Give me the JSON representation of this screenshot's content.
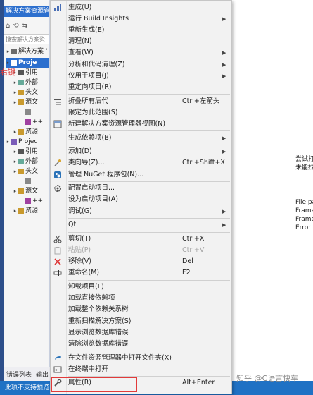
{
  "explorer": {
    "title": "解决方案资源管",
    "search_placeholder": "搜索解决方案资",
    "toolbar": [
      "⌂",
      "⟲",
      "⇆"
    ],
    "right_click_note": "右键",
    "rows": [
      {
        "label": "解决方案 '",
        "depth": 0
      },
      {
        "label": "Proje",
        "depth": 0,
        "selected": true
      },
      {
        "label": "引用",
        "depth": 1
      },
      {
        "label": "外部",
        "depth": 1
      },
      {
        "label": "头文",
        "depth": 1
      },
      {
        "label": "源文",
        "depth": 1
      },
      {
        "label": "",
        "depth": 2
      },
      {
        "label": "++",
        "depth": 2
      },
      {
        "label": "资源",
        "depth": 1
      },
      {
        "label": "Projec",
        "depth": 0
      },
      {
        "label": "引用",
        "depth": 1
      },
      {
        "label": "外部",
        "depth": 1
      },
      {
        "label": "头文",
        "depth": 1
      },
      {
        "label": "",
        "depth": 2
      },
      {
        "label": "源文",
        "depth": 1
      },
      {
        "label": "++",
        "depth": 2
      },
      {
        "label": "资源",
        "depth": 1
      }
    ],
    "tabs": [
      "错误列表",
      "输出"
    ]
  },
  "status": {
    "text": "此项不支持预览"
  },
  "watermark": "知乎 @C语言快车",
  "editor": {
    "lines_top": [
      "尝试打",
      "未能找"
    ],
    "lines_bottom": [
      "File pa",
      "Frame",
      "Frame",
      "Error c"
    ]
  },
  "menu": {
    "items": [
      {
        "icon": "build-icon",
        "label": "生成(U)"
      },
      {
        "icon": "",
        "label": "运行 Build Insights",
        "submenu": true
      },
      {
        "icon": "",
        "label": "重新生成(E)"
      },
      {
        "icon": "",
        "label": "清理(N)"
      },
      {
        "icon": "",
        "label": "查看(W)",
        "submenu": true
      },
      {
        "icon": "",
        "label": "分析和代码清理(Z)",
        "submenu": true
      },
      {
        "icon": "",
        "label": "仅用于项目(J)",
        "submenu": true
      },
      {
        "icon": "",
        "label": "重定向项目(R)"
      },
      {
        "sep": true
      },
      {
        "icon": "collapse-icon",
        "label": "折叠所有后代",
        "shortcut": "Ctrl+左箭头"
      },
      {
        "icon": "",
        "label": "限定为此范围(S)"
      },
      {
        "icon": "new-view-icon",
        "label": "新建解决方案资源管理器视图(N)"
      },
      {
        "sep": true
      },
      {
        "icon": "",
        "label": "生成依赖项(B)",
        "submenu": true
      },
      {
        "sep": true
      },
      {
        "icon": "",
        "label": "添加(D)",
        "submenu": true
      },
      {
        "icon": "class-wizard-icon",
        "label": "类向导(Z)...",
        "shortcut": "Ctrl+Shift+X"
      },
      {
        "icon": "nuget-icon",
        "label": "管理 NuGet 程序包(N)..."
      },
      {
        "sep": true
      },
      {
        "icon": "gear-icon",
        "label": "配置启动项目..."
      },
      {
        "icon": "",
        "label": "设为启动项目(A)"
      },
      {
        "icon": "",
        "label": "调试(G)",
        "submenu": true
      },
      {
        "sep": true
      },
      {
        "icon": "",
        "label": "Qt",
        "submenu": true
      },
      {
        "sep": true
      },
      {
        "icon": "cut-icon",
        "label": "剪切(T)",
        "shortcut": "Ctrl+X"
      },
      {
        "icon": "paste-icon",
        "label": "粘贴(P)",
        "shortcut": "Ctrl+V",
        "disabled": true
      },
      {
        "icon": "remove-icon",
        "label": "移除(V)",
        "shortcut": "Del"
      },
      {
        "icon": "rename-icon",
        "label": "重命名(M)",
        "shortcut": "F2"
      },
      {
        "sep": true
      },
      {
        "icon": "",
        "label": "卸载项目(L)"
      },
      {
        "icon": "",
        "label": "加载直接依赖项"
      },
      {
        "icon": "",
        "label": "加载整个依赖关系树"
      },
      {
        "icon": "",
        "label": "重新扫描解决方案(S)"
      },
      {
        "icon": "",
        "label": "显示浏览数据库错误"
      },
      {
        "icon": "",
        "label": "清除浏览数据库错误"
      },
      {
        "sep": true
      },
      {
        "icon": "open-folder-icon",
        "label": "在文件资源管理器中打开文件夹(X)"
      },
      {
        "icon": "terminal-icon",
        "label": "在终端中打开"
      },
      {
        "sep": true
      },
      {
        "icon": "wrench-icon",
        "label": "属性(R)",
        "shortcut": "Alt+Enter"
      }
    ]
  },
  "colors": {
    "accent": "#2c6fce",
    "highlight": "#e23a3a",
    "status": "#1f71c4"
  }
}
